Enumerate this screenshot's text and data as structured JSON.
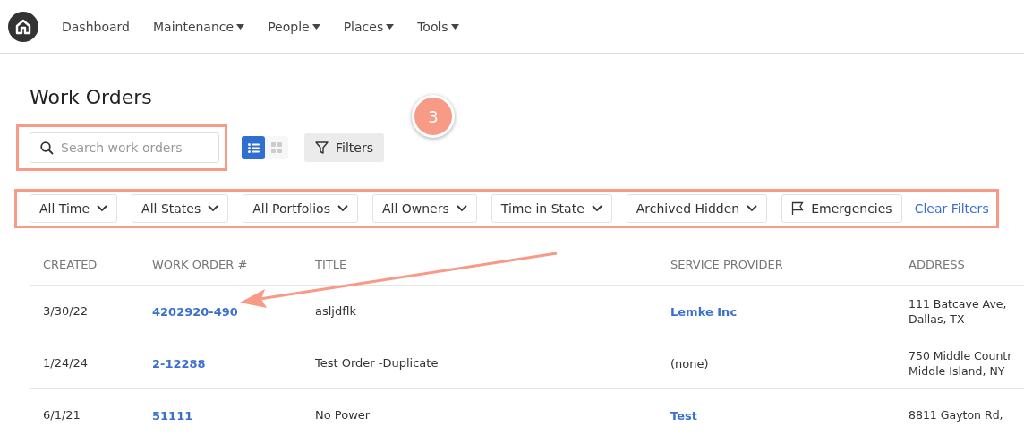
{
  "nav": {
    "items": [
      {
        "label": "Dashboard",
        "dropdown": false
      },
      {
        "label": "Maintenance",
        "dropdown": true
      },
      {
        "label": "People",
        "dropdown": true
      },
      {
        "label": "Places",
        "dropdown": true
      },
      {
        "label": "Tools",
        "dropdown": true
      }
    ]
  },
  "page": {
    "title": "Work Orders"
  },
  "search": {
    "placeholder": "Search work orders"
  },
  "view_toggle": [
    {
      "kind": "list",
      "selected": true
    },
    {
      "kind": "grid",
      "selected": false
    }
  ],
  "filters_button": "Filters",
  "annotation_badge": "3",
  "filters": [
    {
      "kind": "dropdown",
      "label": "All Time"
    },
    {
      "kind": "dropdown",
      "label": "All States"
    },
    {
      "kind": "dropdown",
      "label": "All Portfolios"
    },
    {
      "kind": "dropdown",
      "label": "All Owners"
    },
    {
      "kind": "dropdown",
      "label": "Time in State"
    },
    {
      "kind": "dropdown",
      "label": "Archived Hidden"
    },
    {
      "kind": "toggle",
      "label": "Emergencies"
    },
    {
      "kind": "link",
      "label": "Clear Filters"
    }
  ],
  "table": {
    "columns": [
      "CREATED",
      "WORK ORDER #",
      "TITLE",
      "SERVICE PROVIDER",
      "ADDRESS"
    ],
    "rows": [
      {
        "created": "3/30/22",
        "number": "4202920-490",
        "title": "asljdflk",
        "provider": {
          "text": "Lemke Inc",
          "link": true
        },
        "address": [
          "111 Batcave Ave,",
          "Dallas, TX"
        ]
      },
      {
        "created": "1/24/24",
        "number": "2-12288",
        "title": "Test Order -Duplicate",
        "provider": {
          "text": "(none)",
          "link": false
        },
        "address": [
          "750 Middle Countr",
          "Middle Island, NY"
        ]
      },
      {
        "created": "6/1/21",
        "number": "51111",
        "title": "No Power",
        "provider": {
          "text": "Test",
          "link": true
        },
        "address": [
          "8811 Gayton Rd,"
        ]
      }
    ]
  }
}
